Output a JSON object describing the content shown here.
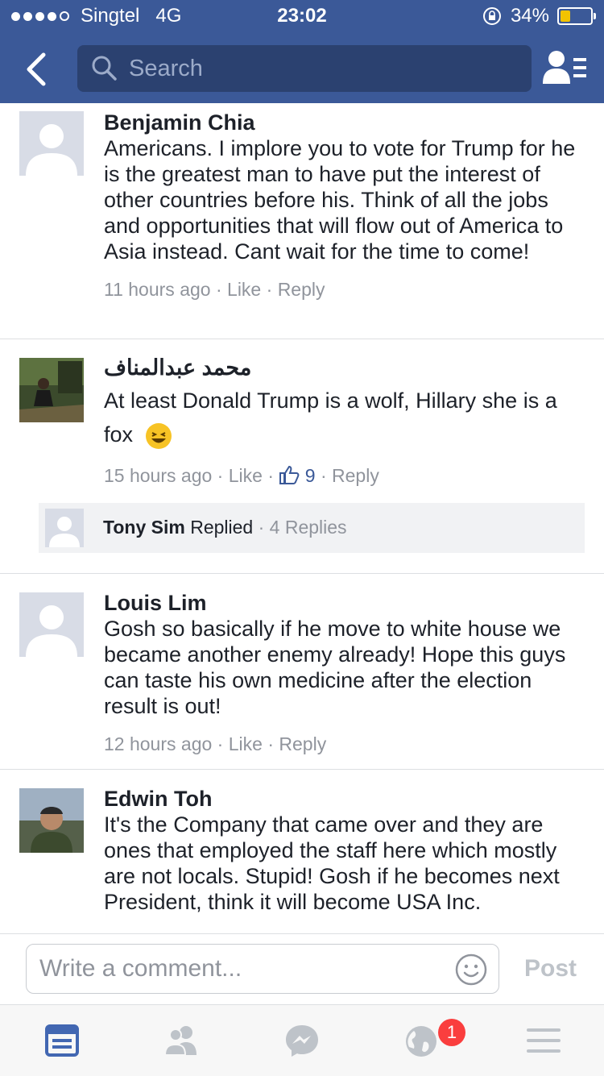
{
  "status_bar": {
    "carrier": "Singtel",
    "network": "4G",
    "time": "23:02",
    "battery": "34%",
    "battery_level": 0.34
  },
  "header": {
    "search_placeholder": "Search"
  },
  "comments": [
    {
      "name": "Benjamin Chia",
      "text": "Americans. I implore you to vote for Trump for he is the greatest man to have put the interest of other countries before his. Think of all the jobs and opportunities that will flow out of America to Asia instead. Cant wait for the time to come!",
      "time": "11 hours ago",
      "like": "Like",
      "reply": "Reply"
    },
    {
      "name": "محمد عبدالمناف",
      "text": "At least Donald Trump is a wolf, Hillary she is a fox",
      "time": "15 hours ago",
      "like": "Like",
      "like_count": "9",
      "reply": "Reply",
      "replies": {
        "name": "Tony Sim",
        "action": "Replied",
        "count": "4 Replies"
      }
    },
    {
      "name": "Louis Lim",
      "text": "Gosh so basically if he move to white house we became another enemy already! Hope this guys can taste his own medicine after the election result is out!",
      "time": "12 hours ago",
      "like": "Like",
      "reply": "Reply"
    },
    {
      "name": "Edwin Toh",
      "text": "It's the Company that came over and they are ones that employed the staff here which mostly are not locals. Stupid! Gosh if he becomes next President, think it will become USA Inc."
    }
  ],
  "composer": {
    "placeholder": "Write a comment...",
    "post_label": "Post"
  },
  "tabbar": {
    "notification_badge": "1"
  },
  "colors": {
    "brand": "#3b5998",
    "meta": "#90949c",
    "badge": "#fa3e3e"
  }
}
